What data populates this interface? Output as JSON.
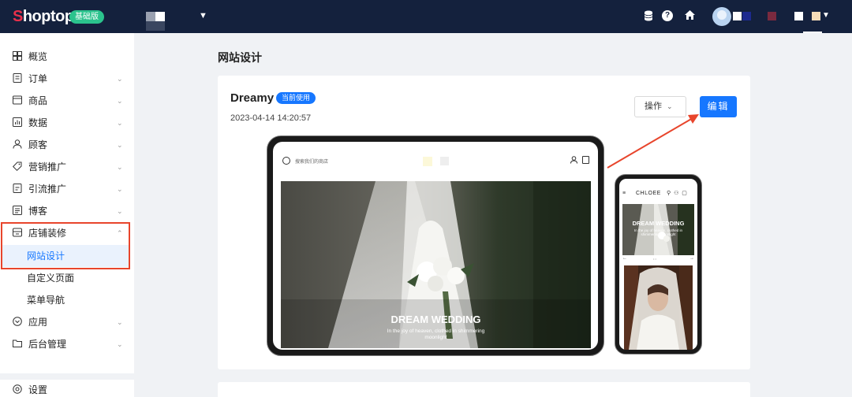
{
  "topbar": {
    "logo": "Shoptop",
    "plan_badge": "基础版",
    "store_caret": "▼",
    "icons": [
      "database-icon",
      "help-icon",
      "home-icon",
      "avatar",
      "chevron-down-icon"
    ]
  },
  "sidebar": {
    "items": [
      {
        "label": "概览",
        "icon": "dashboard-icon",
        "chevron": ""
      },
      {
        "label": "订单",
        "icon": "order-icon",
        "chevron": "⌄"
      },
      {
        "label": "商品",
        "icon": "product-icon",
        "chevron": "⌄"
      },
      {
        "label": "数据",
        "icon": "chart-icon",
        "chevron": "⌄"
      },
      {
        "label": "顾客",
        "icon": "customer-icon",
        "chevron": "⌄"
      },
      {
        "label": "营销推广",
        "icon": "tag-icon",
        "chevron": "⌄"
      },
      {
        "label": "引流推广",
        "icon": "traffic-icon",
        "chevron": "⌄"
      },
      {
        "label": "博客",
        "icon": "blog-icon",
        "chevron": "⌄"
      },
      {
        "label": "店铺装修",
        "icon": "store-icon",
        "chevron": "⌃"
      }
    ],
    "sub_items": [
      {
        "label": "网站设计",
        "active": true
      },
      {
        "label": "自定义页面",
        "active": false
      },
      {
        "label": "菜单导航",
        "active": false
      }
    ],
    "items_bottom": [
      {
        "label": "应用",
        "icon": "apps-icon",
        "chevron": "⌄"
      },
      {
        "label": "后台管理",
        "icon": "folder-icon",
        "chevron": "⌄"
      }
    ],
    "settings": {
      "label": "设置",
      "icon": "gear-icon"
    }
  },
  "main": {
    "page_title": "网站设计",
    "theme": {
      "name": "Dreamy",
      "status_badge": "当前使用",
      "date": "2023-04-14 14:20:57",
      "actions_label": "操作",
      "actions_caret": "⌄",
      "edit_label": "编辑"
    },
    "preview_tablet": {
      "search_placeholder": "搜索我们的商店",
      "hero_title": "DREAM WEDDING",
      "hero_subtitle": "In the joy of heaven, clothed in shimmering moonlight"
    },
    "preview_phone": {
      "brand": "CHLOEE",
      "menu": "≡",
      "icons": "⚲ ⚇ ▢",
      "hero_title": "DREAM WEDDING",
      "hero_subtitle": "In the joy of heaven, clothed in shimmering moonlight",
      "prev": "←",
      "next": "→",
      "dots": "• •"
    }
  },
  "colors": {
    "topbar": "#14213d",
    "accent": "#1677ff",
    "plan_badge": "#2bc38d",
    "highlight": "#e8452c"
  }
}
